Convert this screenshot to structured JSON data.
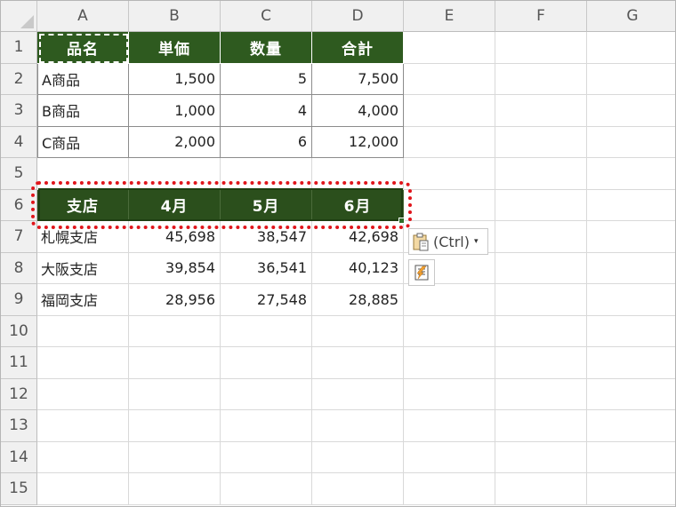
{
  "columns": [
    "A",
    "B",
    "C",
    "D",
    "E",
    "F",
    "G"
  ],
  "row_numbers": [
    "1",
    "2",
    "3",
    "4",
    "5",
    "6",
    "7",
    "8",
    "9",
    "10",
    "11",
    "12",
    "13",
    "14",
    "15"
  ],
  "table1": {
    "headers": [
      "品名",
      "単価",
      "数量",
      "合計"
    ],
    "rows": [
      [
        "A商品",
        "1,500",
        "5",
        "7,500"
      ],
      [
        "B商品",
        "1,000",
        "4",
        "4,000"
      ],
      [
        "C商品",
        "2,000",
        "6",
        "12,000"
      ]
    ]
  },
  "table2": {
    "headers": [
      "支店",
      "4月",
      "5月",
      "6月"
    ],
    "rows": [
      [
        "札幌支店",
        "45,698",
        "38,547",
        "42,698"
      ],
      [
        "大阪支店",
        "39,854",
        "36,541",
        "40,123"
      ],
      [
        "福岡支店",
        "28,956",
        "27,548",
        "28,885"
      ]
    ]
  },
  "paste_options": {
    "label": "(Ctrl)",
    "caret": "▾"
  },
  "colors": {
    "header_green": "#2e5a1f",
    "highlight_red": "#e0151b",
    "selection_green": "#1e3f12"
  }
}
